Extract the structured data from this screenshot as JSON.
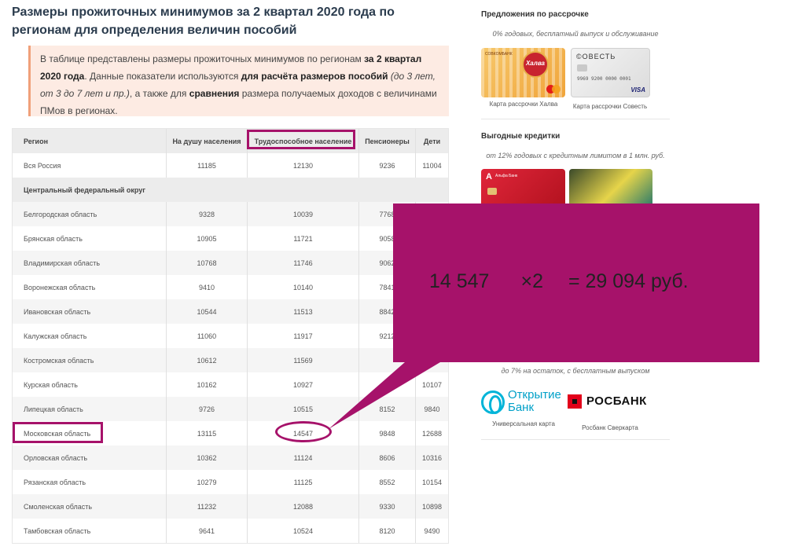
{
  "page": {
    "title": "Размеры прожиточных минимумов за 2 квартал 2020 года по регионам для определения величин пособий"
  },
  "info": {
    "t1": "В таблице представлены размеры прожиточных минимумов по регионам ",
    "b1": "за 2 квартал 2020 года",
    "t2": ". Данные показатели используются ",
    "b2": "для расчёта размеров пособий",
    "t3": " ",
    "i1": "(до 3 лет, от 3 до 7 лет и пр.)",
    "t4": ", а также для ",
    "b3": "сравнения",
    "t5": " размера получаемых доходов с величинами ПМов в регионах."
  },
  "table": {
    "headers": [
      "Регион",
      "На душу населения",
      "Трудоспособное население",
      "Пенсионеры",
      "Дети"
    ],
    "top_rows": [
      [
        "Вся Россия",
        "11185",
        "12130",
        "9236",
        "11004"
      ]
    ],
    "section": "Центральный федеральный округ",
    "rows": [
      [
        "Белгородская область",
        "9328",
        "10039",
        "7768",
        ""
      ],
      [
        "Брянская область",
        "10905",
        "11721",
        "9058",
        ""
      ],
      [
        "Владимирская область",
        "10768",
        "11746",
        "9062",
        ""
      ],
      [
        "Воронежская область",
        "9410",
        "10140",
        "7841",
        ""
      ],
      [
        "Ивановская область",
        "10544",
        "11513",
        "8842",
        ""
      ],
      [
        "Калужская область",
        "11060",
        "11917",
        "9212",
        ""
      ],
      [
        "Костромская область",
        "10612",
        "11569",
        "",
        ""
      ],
      [
        "Курская область",
        "10162",
        "10927",
        "",
        "10107"
      ],
      [
        "Липецкая область",
        "9726",
        "10515",
        "8152",
        "9840"
      ],
      [
        "Московская область",
        "13115",
        "14547",
        "9848",
        "12688"
      ],
      [
        "Орловская область",
        "10362",
        "11124",
        "8606",
        "10316"
      ],
      [
        "Рязанская область",
        "10279",
        "11125",
        "8552",
        "10154"
      ],
      [
        "Смоленская область",
        "11232",
        "12088",
        "9330",
        "10898"
      ],
      [
        "Тамбовская область",
        "9641",
        "10524",
        "8120",
        "9490"
      ]
    ]
  },
  "callout": {
    "value": "14 547",
    "times": "×2",
    "result": "= 29 094 руб."
  },
  "sidebar": {
    "installments": {
      "heading": "Предложения по рассрочке",
      "subtitle": "0% годовых, бесплатный выпуск и обслуживание",
      "cards": [
        {
          "caption": "Карта рассрочки Халва",
          "seal": "Халва",
          "bank": "СОВКОМБАНК"
        },
        {
          "caption": "Карта рассрочки Совесть",
          "logo": "©ОВЕСТЬ",
          "number": "9969 9200 0000 0001",
          "network": "VISA"
        }
      ]
    },
    "credit": {
      "heading": "Выгодные кредитки",
      "subtitle": "от 12% годовых с кредитным лимитом в 1 млн. руб.",
      "cards": [
        {
          "logo": "А",
          "bank": "Альфа Банк"
        }
      ]
    },
    "debit": {
      "subtitle": "до 7% на остаток, с бесплатным выпуском",
      "cards": [
        {
          "line1": "Открытие",
          "line2": "Банк",
          "caption": "Универсальная карта"
        },
        {
          "name": "РОСБАНК",
          "caption": "Росбанк Сверкарта"
        }
      ]
    }
  },
  "colors": {
    "highlight": "#a6126a",
    "callout_fill": "#a6126a",
    "info_bg": "#fdebe3"
  }
}
